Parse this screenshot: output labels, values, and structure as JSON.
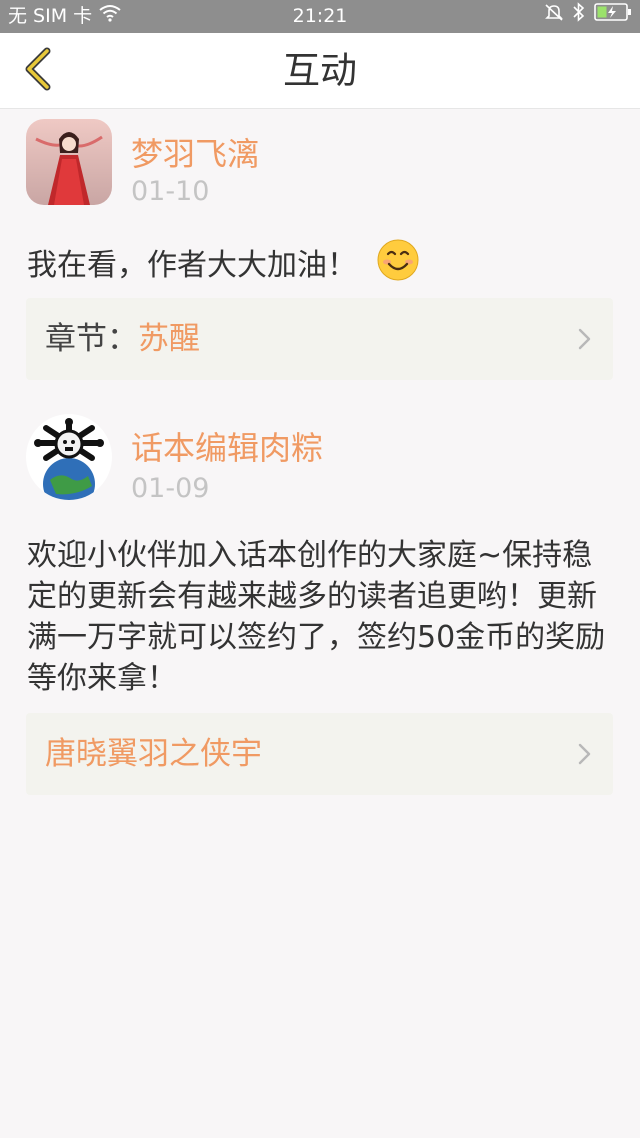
{
  "status_bar": {
    "carrier": "无 SIM 卡",
    "time": "21:21",
    "icons": [
      "wifi-icon",
      "mute-icon",
      "bluetooth-icon",
      "battery-charging-icon"
    ]
  },
  "nav": {
    "title": "互动",
    "back_icon": "back-chevron-icon"
  },
  "comments": [
    {
      "user": "梦羽飞漓",
      "date": "01-10",
      "text": "我在看，作者大大加油！",
      "emoji": "😊",
      "link_prefix": "章节：",
      "link_value": "苏醒"
    },
    {
      "user": "话本编辑肉粽",
      "date": "01-09",
      "text": "欢迎小伙伴加入话本创作的大家庭~保持稳定的更新会有越来越多的读者追更哟！更新满一万字就可以签约了，签约50金币的奖励等你来拿！",
      "link_value": "唐晓翼羽之侠宇"
    }
  ],
  "colors": {
    "accent": "#f09a63",
    "status_bar": "#8e8e8e",
    "back_icon": "#e8c93a"
  }
}
